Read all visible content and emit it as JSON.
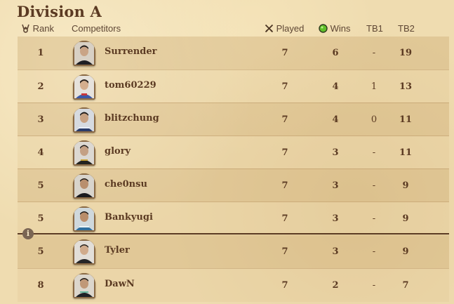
{
  "title": "Division A",
  "columns": {
    "rank": "Rank",
    "competitors": "Competitors",
    "played": "Played",
    "wins": "Wins",
    "tb1": "TB1",
    "tb2": "TB2"
  },
  "icons": {
    "rank": "trophy-icon",
    "played": "crossed-swords-icon",
    "wins": "green-gem-icon",
    "info": "info-icon"
  },
  "colors": {
    "wins_gem": "#5fbf2a",
    "cutline": "#5b3a22"
  },
  "standings": [
    {
      "rank": "1",
      "name": "Surrender",
      "played": "7",
      "wins": "6",
      "tb1": "-",
      "tb2": "19"
    },
    {
      "rank": "2",
      "name": "tom60229",
      "played": "7",
      "wins": "4",
      "tb1": "1",
      "tb2": "13"
    },
    {
      "rank": "3",
      "name": "blitzchung",
      "played": "7",
      "wins": "4",
      "tb1": "0",
      "tb2": "11"
    },
    {
      "rank": "4",
      "name": "glory",
      "played": "7",
      "wins": "3",
      "tb1": "-",
      "tb2": "11"
    },
    {
      "rank": "5",
      "name": "che0nsu",
      "played": "7",
      "wins": "3",
      "tb1": "-",
      "tb2": "9"
    },
    {
      "rank": "5",
      "name": "Bankyugi",
      "played": "7",
      "wins": "3",
      "tb1": "-",
      "tb2": "9"
    },
    {
      "rank": "5",
      "name": "Tyler",
      "played": "7",
      "wins": "3",
      "tb1": "-",
      "tb2": "9"
    },
    {
      "rank": "8",
      "name": "DawN",
      "played": "7",
      "wins": "2",
      "tb1": "-",
      "tb2": "7"
    }
  ]
}
